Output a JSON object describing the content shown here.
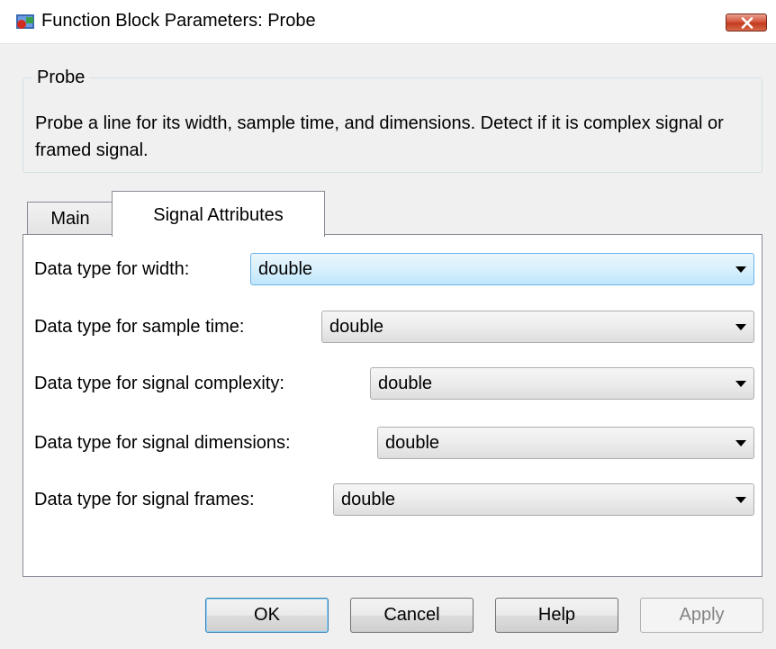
{
  "window": {
    "title": "Function Block Parameters: Probe",
    "icon": "simulink-block-icon",
    "close_icon": "close-icon"
  },
  "group": {
    "title": "Probe",
    "description": "Probe a line for its width, sample time, and dimensions. Detect if it is complex signal or framed signal."
  },
  "tabs": [
    {
      "label": "Main",
      "selected": false
    },
    {
      "label": "Signal Attributes",
      "selected": true
    }
  ],
  "fields": [
    {
      "label": "Data type for width:",
      "value": "double"
    },
    {
      "label": "Data type for sample time:",
      "value": "double"
    },
    {
      "label": "Data type for signal complexity:",
      "value": "double"
    },
    {
      "label": "Data type for signal dimensions:",
      "value": "double"
    },
    {
      "label": "Data type for signal frames:",
      "value": "double"
    }
  ],
  "buttons": {
    "ok": "OK",
    "cancel": "Cancel",
    "help": "Help",
    "apply": "Apply"
  },
  "colors": {
    "focus_border": "#6db3e3",
    "close_button": "#c23a1f"
  }
}
